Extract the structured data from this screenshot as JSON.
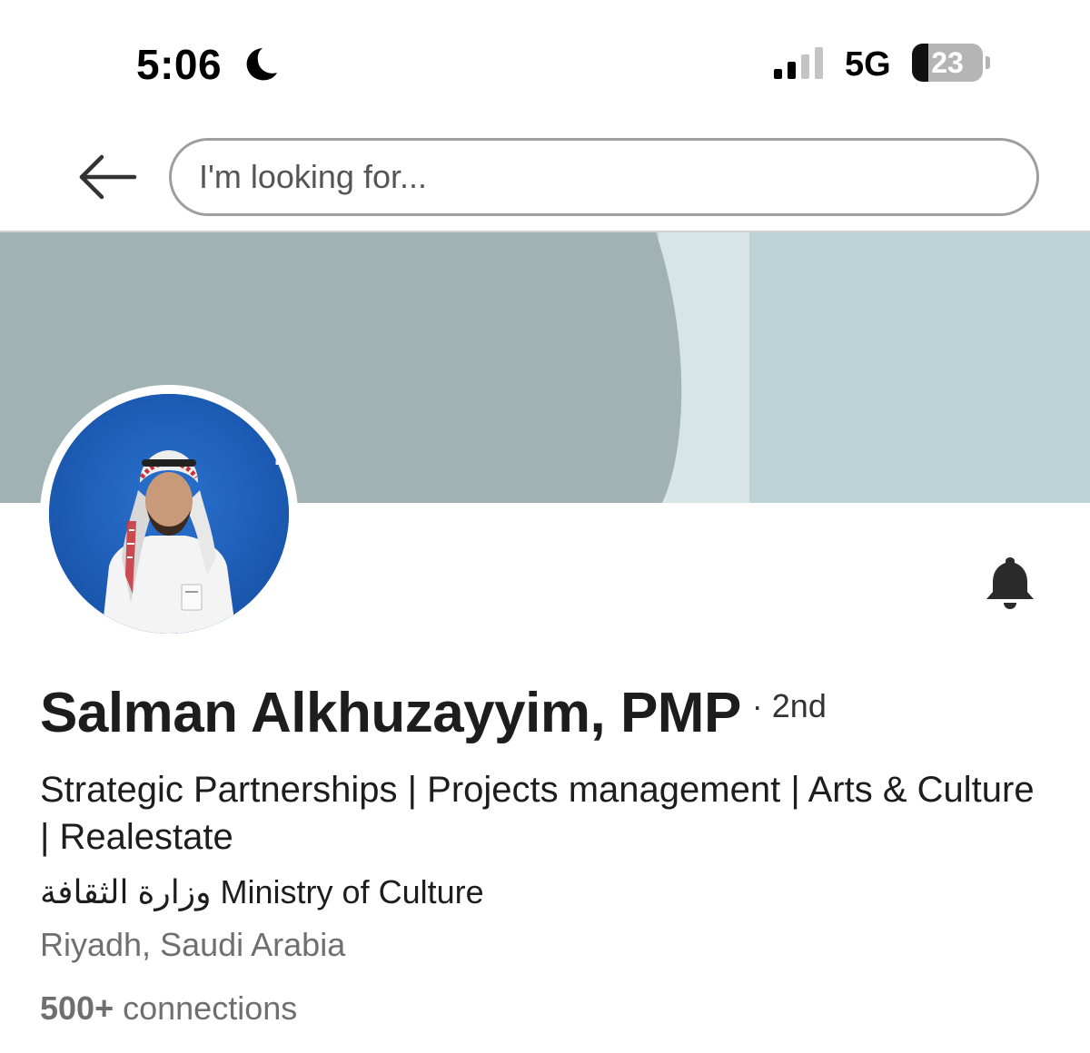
{
  "status_bar": {
    "time": "5:06",
    "network": "5G",
    "battery_level": "23",
    "battery_fraction": 0.23,
    "focus_icon": "moon-icon",
    "signal_icon": "signal-icon"
  },
  "header": {
    "back_icon": "arrow-left-icon",
    "search_placeholder": "I'm looking for..."
  },
  "cover": {
    "colors": {
      "left_panel": "#a0b2b4",
      "middle_strip": "#d8e5e7",
      "right_panel": "#bed3d6"
    }
  },
  "avatar": {
    "sign_text": "قيادة العـ",
    "background_color": "#1b5fba"
  },
  "actions": {
    "bell_icon": "bell-icon"
  },
  "profile": {
    "name": "Salman Alkhuzayyim, PMP",
    "degree": "· 2nd",
    "headline": "Strategic Partnerships | Projects management | Arts & Culture | Realestate",
    "company": "وزارة الثقافة Ministry of Culture",
    "location": "Riyadh, Saudi Arabia",
    "connections_count": "500+",
    "connections_label": "connections"
  }
}
